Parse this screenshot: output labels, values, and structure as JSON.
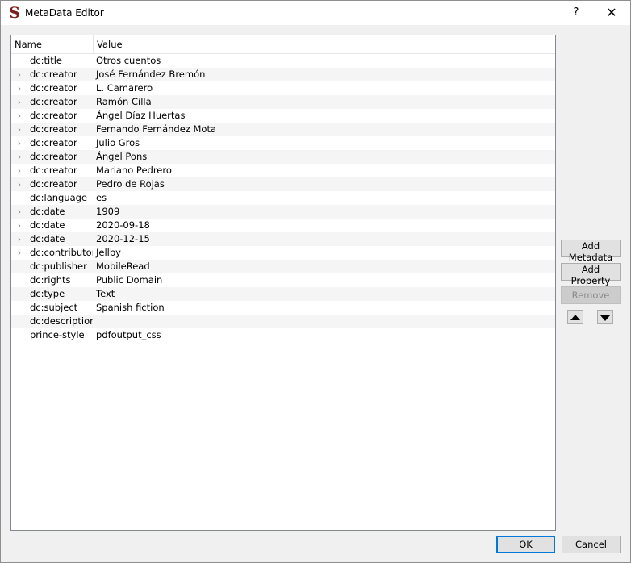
{
  "window": {
    "title": "MetaData Editor",
    "help_label": "?",
    "close_label": "✕"
  },
  "tree": {
    "columns": {
      "name": "Name",
      "value": "Value"
    },
    "rows": [
      {
        "name": "dc:title",
        "value": "Otros cuentos",
        "expandable": false
      },
      {
        "name": "dc:creator",
        "value": "José Fernández Bremón",
        "expandable": true
      },
      {
        "name": "dc:creator",
        "value": "L. Camarero",
        "expandable": true
      },
      {
        "name": "dc:creator",
        "value": "Ramón Cilla",
        "expandable": true
      },
      {
        "name": "dc:creator",
        "value": "Ángel Díaz Huertas",
        "expandable": true
      },
      {
        "name": "dc:creator",
        "value": "Fernando Fernández Mota",
        "expandable": true
      },
      {
        "name": "dc:creator",
        "value": "Julio Gros",
        "expandable": true
      },
      {
        "name": "dc:creator",
        "value": "Ángel Pons",
        "expandable": true
      },
      {
        "name": "dc:creator",
        "value": "Mariano Pedrero",
        "expandable": true
      },
      {
        "name": "dc:creator",
        "value": "Pedro de Rojas",
        "expandable": true
      },
      {
        "name": "dc:language",
        "value": "es",
        "expandable": false
      },
      {
        "name": "dc:date",
        "value": "1909",
        "expandable": true
      },
      {
        "name": "dc:date",
        "value": "2020-09-18",
        "expandable": true
      },
      {
        "name": "dc:date",
        "value": "2020-12-15",
        "expandable": true
      },
      {
        "name": "dc:contributor",
        "value": "Jellby",
        "expandable": true
      },
      {
        "name": "dc:publisher",
        "value": "MobileRead",
        "expandable": false
      },
      {
        "name": "dc:rights",
        "value": "Public Domain",
        "expandable": false
      },
      {
        "name": "dc:type",
        "value": "Text",
        "expandable": false
      },
      {
        "name": "dc:subject",
        "value": "Spanish fiction",
        "expandable": false
      },
      {
        "name": "dc:description",
        "value": "",
        "expandable": false
      },
      {
        "name": "prince-style",
        "value": "pdfoutput_css",
        "expandable": false
      }
    ]
  },
  "side_buttons": {
    "add_metadata": "Add Metadata",
    "add_property": "Add Property",
    "remove": "Remove"
  },
  "footer": {
    "ok": "OK",
    "cancel": "Cancel"
  },
  "icons": {
    "expand": "chevron-right-icon",
    "move_up": "arrow-up-icon",
    "move_down": "arrow-down-icon"
  }
}
